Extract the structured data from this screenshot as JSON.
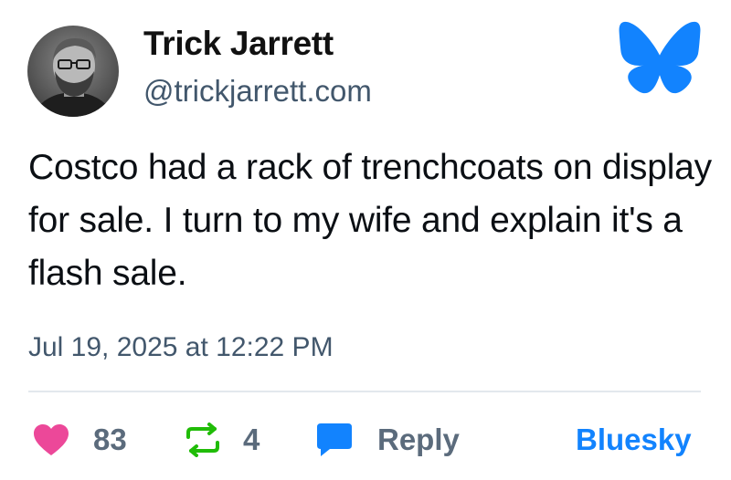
{
  "author": {
    "display_name": "Trick Jarrett",
    "handle": "@trickjarrett.com",
    "avatar_icon": "avatar-photo"
  },
  "brand": {
    "logo_icon": "bluesky-butterfly-icon",
    "color": "#1283fe"
  },
  "post": {
    "text": "Costco had a rack of trenchcoats on display for sale. I turn to my wife and explain it's a flash sale.",
    "timestamp": "Jul 19, 2025 at 12:22 PM"
  },
  "actions": {
    "likes": {
      "icon": "heart-icon",
      "count": "83",
      "color": "#ec4899"
    },
    "reposts": {
      "icon": "repost-icon",
      "count": "4",
      "color": "#20bc07"
    },
    "reply": {
      "icon": "speech-bubble-icon",
      "label": "Reply",
      "color": "#1283fe"
    },
    "open_link": {
      "label": "Bluesky"
    }
  }
}
